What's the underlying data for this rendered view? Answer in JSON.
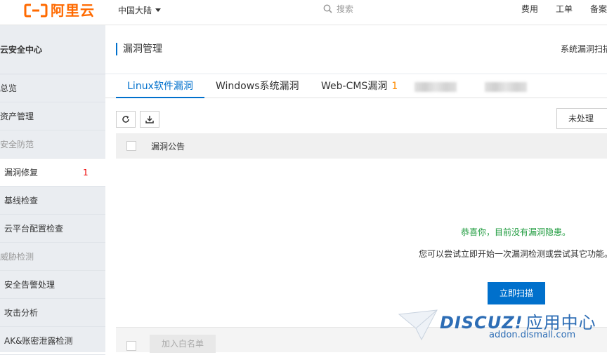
{
  "topbar": {
    "brand": "阿里云",
    "region": "中国大陆",
    "search_placeholder": "搜索",
    "links": [
      "费用",
      "工单",
      "备案"
    ]
  },
  "sidebar": {
    "title": "云安全中心",
    "items": [
      {
        "label": "总览"
      },
      {
        "label": "资产管理"
      },
      {
        "label": "安全防范"
      },
      {
        "label": "漏洞修复",
        "badge": "1"
      },
      {
        "label": "基线检查"
      },
      {
        "label": "云平台配置检查"
      },
      {
        "label": "威胁检测"
      },
      {
        "label": "安全告警处理"
      },
      {
        "label": "攻击分析"
      },
      {
        "label": "AK&账密泄露检测"
      }
    ]
  },
  "page": {
    "title": "漏洞管理",
    "scan_settings": "系统漏洞扫描"
  },
  "tabs": [
    {
      "label": "Linux软件漏洞"
    },
    {
      "label": "Windows系统漏洞"
    },
    {
      "label": "Web-CMS漏洞",
      "badge": "1"
    }
  ],
  "filter": {
    "status": "未处理"
  },
  "table": {
    "header": "漏洞公告"
  },
  "empty_state": {
    "congrats": "恭喜你，目前没有漏洞隐患。",
    "hint": "您可以尝试立即开始一次漏洞检测或尝试其它功能。",
    "button": "立即扫描"
  },
  "footer": {
    "whitelist_button": "加入白名单"
  },
  "watermark": {
    "brand": "DISCUZ!",
    "suffix": "应用中心",
    "url": "addon.dismall.com"
  },
  "colors": {
    "brand": "#ff6a00",
    "accent": "#0070cc",
    "success": "#1e9b3e",
    "badge": "#ff8a00"
  }
}
